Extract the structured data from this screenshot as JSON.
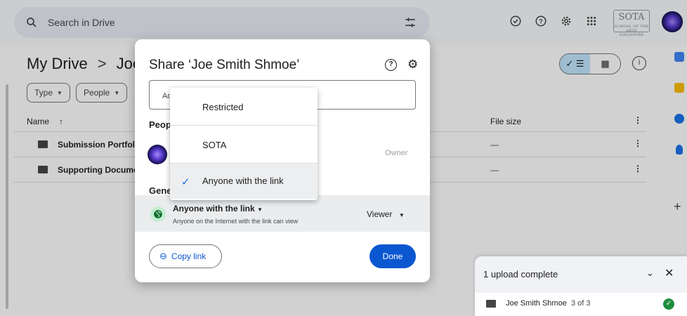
{
  "search": {
    "placeholder": "Search in Drive"
  },
  "logo": {
    "text": "SOTA",
    "subtext": "SCHOOL OF THE ARTS SINGAPORE"
  },
  "breadcrumb": {
    "root": "My Drive",
    "separator": ">",
    "current": "Joe"
  },
  "filters": {
    "type": "Type",
    "people": "People"
  },
  "table": {
    "col_name": "Name",
    "col_size": "File size",
    "rows": [
      {
        "name": "Submission Portfolio",
        "size": "—"
      },
      {
        "name": "Supporting Docume",
        "size": "—"
      }
    ]
  },
  "share_dialog": {
    "title": "Share ‘Joe Smith Shmoe’",
    "add_placeholder": "Ad",
    "people_header": "Peop",
    "owner_label": "Owner",
    "general_header": "Gene",
    "access_label": "Anyone with the link",
    "access_desc": "Anyone on the Internet with the link can view",
    "role": "Viewer",
    "copy_link": "Copy link",
    "done": "Done"
  },
  "access_menu": {
    "items": [
      {
        "label": "Restricted",
        "selected": false
      },
      {
        "label": "SOTA",
        "selected": false
      },
      {
        "label": "Anyone with the link",
        "selected": true
      }
    ]
  },
  "upload": {
    "title": "1 upload complete",
    "item_name": "Joe Smith Shmoe",
    "item_count": "3 of 3"
  },
  "colors": {
    "primary": "#0b57d0",
    "selected_view": "#c2e7ff",
    "success": "#1e8e3e"
  }
}
